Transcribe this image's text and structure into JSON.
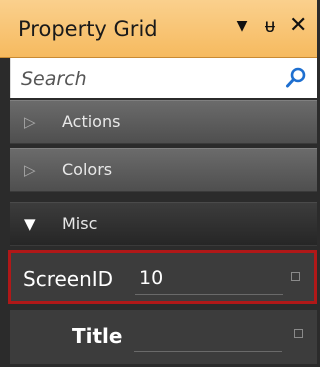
{
  "panel": {
    "title": "Property Grid",
    "dropdown_icon": "caret-down-icon",
    "pin_icon": "pin-icon",
    "close_icon": "close-icon",
    "dropdown_glyph": "▼",
    "pin_glyph": "ᵾ",
    "close_glyph": "✕"
  },
  "search": {
    "placeholder": "Search",
    "value": "",
    "icon": "search-icon"
  },
  "categories": [
    {
      "label": "Actions",
      "expanded": false,
      "arrow": "▷"
    },
    {
      "label": "Colors",
      "expanded": false,
      "arrow": "▷"
    },
    {
      "label": "Misc",
      "expanded": true,
      "arrow": "▼"
    }
  ],
  "properties": [
    {
      "name": "ScreenID",
      "value": "10",
      "selected": true
    },
    {
      "name": "Title",
      "value": "",
      "selected": false
    }
  ],
  "colors": {
    "title_bar": "#f6ba5f",
    "selection_border": "#b01818",
    "search_icon": "#1e6fd0"
  }
}
